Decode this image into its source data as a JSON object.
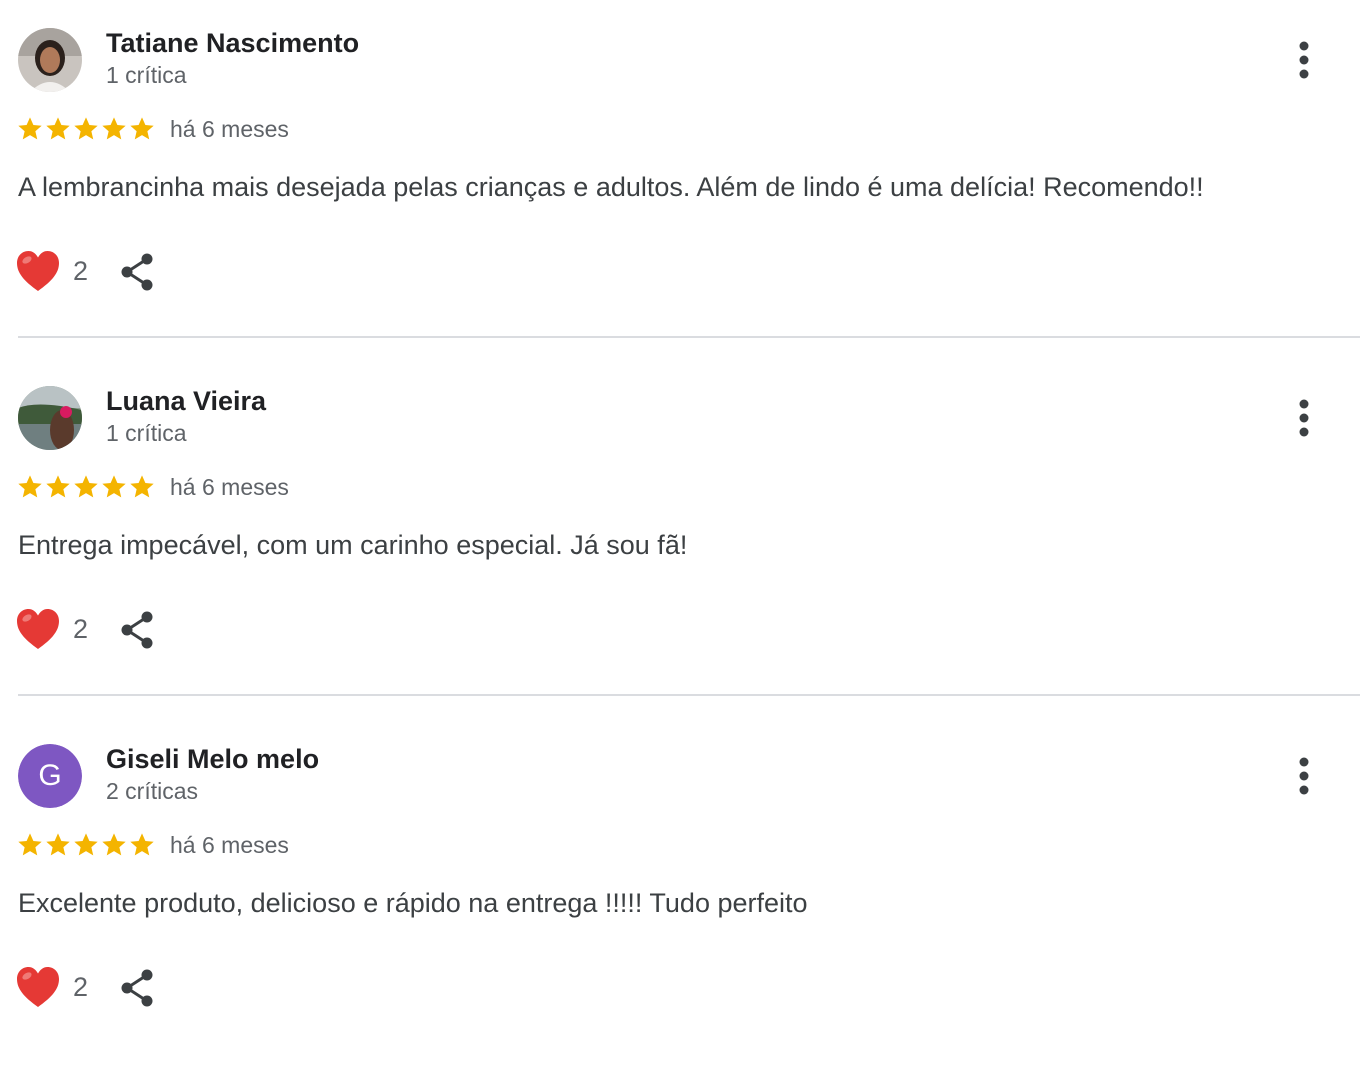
{
  "reviews": [
    {
      "name": "Tatiane Nascimento",
      "review_count": "1 crítica",
      "rating": 5,
      "time": "há 6 meses",
      "text": "A lembrancinha mais desejada pelas crianças e adultos. Além de lindo é uma delícia! Recomendo!!",
      "likes": "2",
      "avatar": "photo"
    },
    {
      "name": "Luana Vieira",
      "review_count": "1 crítica",
      "rating": 5,
      "time": "há 6 meses",
      "text": "Entrega impecável, com um carinho especial. Já sou fã!",
      "likes": "2",
      "avatar": "photo"
    },
    {
      "name": "Giseli Melo melo",
      "review_count": "2 críticas",
      "rating": 5,
      "time": "há 6 meses",
      "text": "Excelente produto, delicioso e rápido na entrega !!!!! Tudo perfeito",
      "likes": "2",
      "avatar": "G",
      "avatar_color": "#7e57c2"
    }
  ],
  "colors": {
    "star": "#f4b400",
    "heart": "#e53935",
    "icon": "#3c4043",
    "divider": "#dadce0"
  },
  "icons": {
    "more": "more-vert-icon",
    "like": "heart-icon",
    "share": "share-icon",
    "star": "star-icon"
  }
}
